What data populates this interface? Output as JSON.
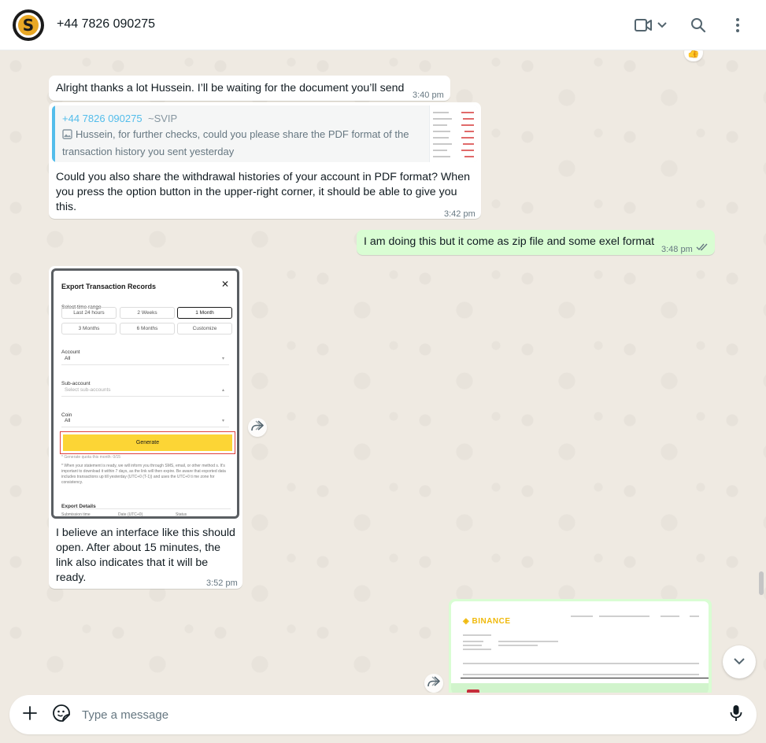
{
  "header": {
    "avatar_letter": "S",
    "contact_name": "+44 7826 090275"
  },
  "messages": {
    "reaction_emoji": "👍",
    "m1": {
      "text": "Alright thanks a lot Hussein. I’ll be waiting for the document you’ll send",
      "time": "3:40 pm"
    },
    "m2": {
      "quote_author": "+44 7826 090275",
      "quote_pushname": "~SVIP",
      "quote_text": "Hussein, for further checks, could you please share the PDF format of the transaction history you sent yesterday",
      "text": "Could you also share the withdrawal histories of your account in PDF format? When you press the option button in the upper-right corner, it should be able to give you this.",
      "time": "3:42 pm"
    },
    "m3": {
      "text": "I am doing this but it come as zip file and some exel format",
      "time": "3:48 pm"
    },
    "m4": {
      "image": {
        "title": "Export Transaction Records",
        "close": "✕",
        "time_range_label": "Select time range",
        "ranges": [
          "Last 24 hours",
          "2 Weeks",
          "1 Month",
          "3 Months",
          "6 Months",
          "Customize"
        ],
        "account_label": "Account",
        "account_value": "All",
        "subaccount_label": "Sub-account",
        "subaccount_placeholder": "Select sub-accounts",
        "coin_label": "Coin",
        "coin_value": "All",
        "generate": "Generate",
        "quota": "* Generate quota this month: 0/15",
        "note": "* When your statement is ready, we will inform you through SMS, email, or other method s. It's important to download it within 7 days, as the link will then expire. Be aware that exported data includes transactions up till yesterday (UTC+0 (T-1)) and uses the UTC+0 ti me zone for consistency.",
        "export_details": "Export Details",
        "col_submission": "Submission time",
        "col_date": "Date (UTC+0)",
        "col_status": "Status"
      },
      "text": "I believe an interface like this should open. After about 15 minutes, the link also indicates that it will be ready.",
      "time": "3:52 pm"
    },
    "m5": {
      "image": {
        "brand": "BINANCE"
      }
    }
  },
  "composer": {
    "placeholder": "Type a message"
  },
  "icons": {
    "video": "video-call-icon",
    "chevron": "chevron-down-icon",
    "search": "search-icon",
    "menu": "menu-icon",
    "forward": "forward-icon",
    "plus": "plus-icon",
    "sticker": "sticker-icon",
    "mic": "mic-icon"
  },
  "colors": {
    "outgoing": "#d9fdd3",
    "incoming": "#ffffff",
    "quote_accent": "#53bdeb",
    "wallpaper": "#efeae2"
  }
}
